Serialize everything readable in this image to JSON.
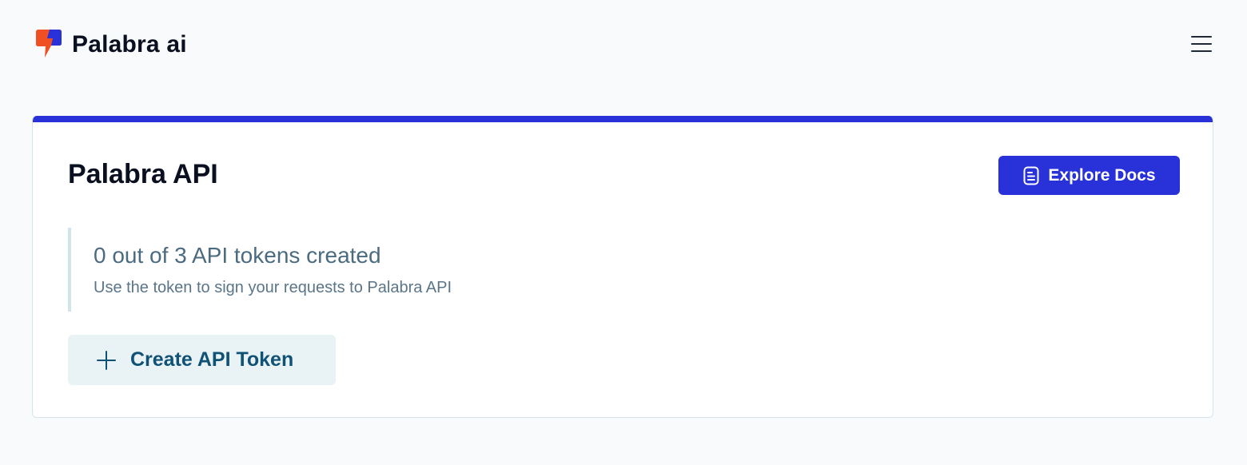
{
  "header": {
    "brand_name": "Palabra ai",
    "logo_icon": "palabra-logo",
    "menu_icon": "hamburger-menu-icon"
  },
  "card": {
    "accent_color": "#2931d9",
    "title": "Palabra API",
    "docs_button": {
      "label": "Explore Docs",
      "icon": "document-icon"
    },
    "tokens": {
      "summary": "0 out of 3 API tokens created",
      "description": "Use the token to sign your requests to Palabra API"
    },
    "create_button": {
      "label": "Create API Token",
      "icon": "plus-icon"
    }
  }
}
